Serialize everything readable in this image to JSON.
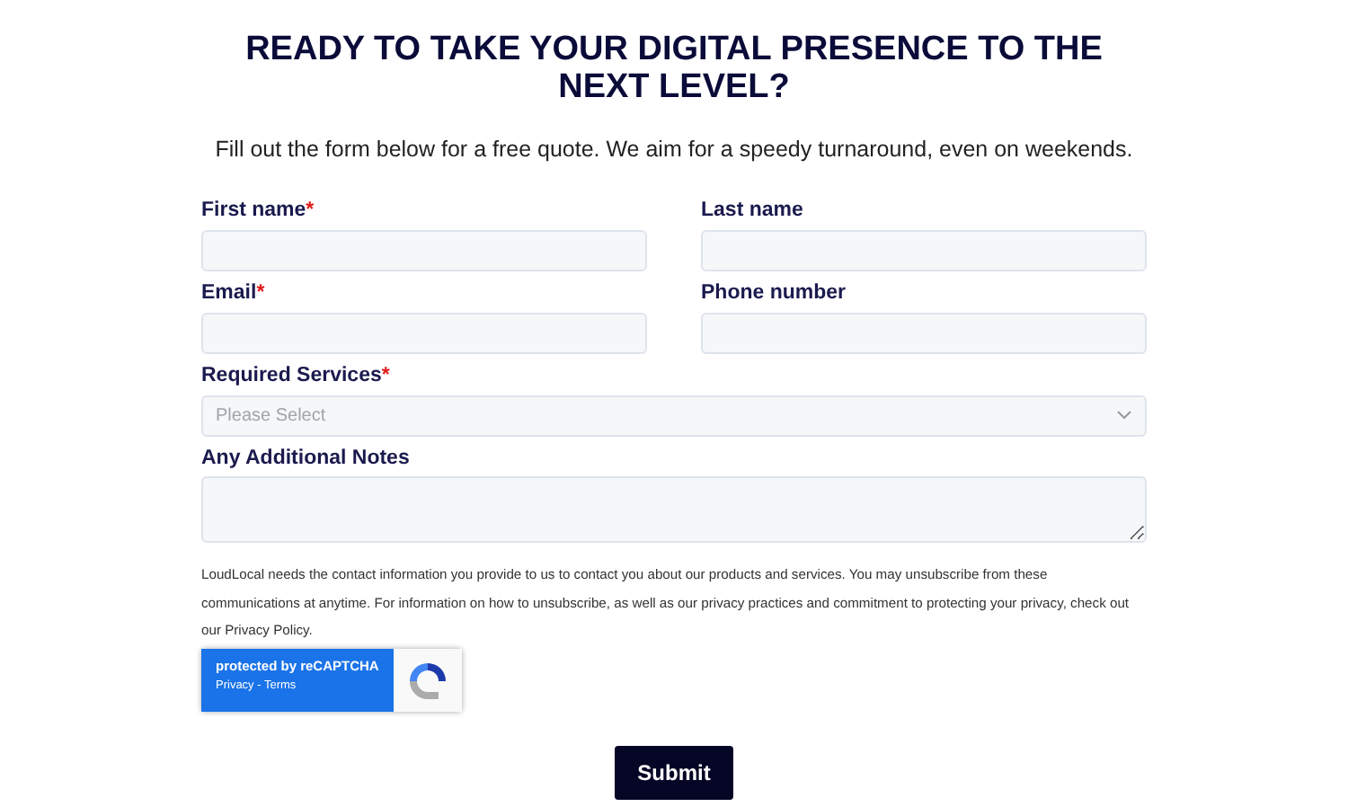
{
  "heading": "READY TO TAKE YOUR DIGITAL PRESENCE TO THE NEXT LEVEL?",
  "subtitle": "Fill out the form below for a free quote. We aim for a speedy turnaround, even on weekends.",
  "fields": [
    {
      "label": "First name",
      "required": true,
      "kind": "text",
      "half": true
    },
    {
      "label": "Last name",
      "required": false,
      "kind": "text",
      "half": true
    },
    {
      "label": "Email",
      "required": true,
      "kind": "text",
      "half": true
    },
    {
      "label": "Phone number",
      "required": false,
      "kind": "text",
      "half": true
    },
    {
      "label": "Required Services",
      "required": true,
      "kind": "select",
      "half": false,
      "placeholder": "Please Select"
    },
    {
      "label": "Any Additional Notes",
      "required": false,
      "kind": "textarea",
      "half": false
    }
  ],
  "required_mark": "*",
  "consent": "LoudLocal needs the contact information you provide to us to contact you about our products and services. You may unsubscribe from these communications at anytime. For information on how to unsubscribe, as well as our privacy practices and commitment to protecting your privacy, check out our Privacy Policy.",
  "recaptcha": {
    "title": "protected by reCAPTCHA",
    "links": "Privacy - Terms"
  },
  "submit": "Submit"
}
